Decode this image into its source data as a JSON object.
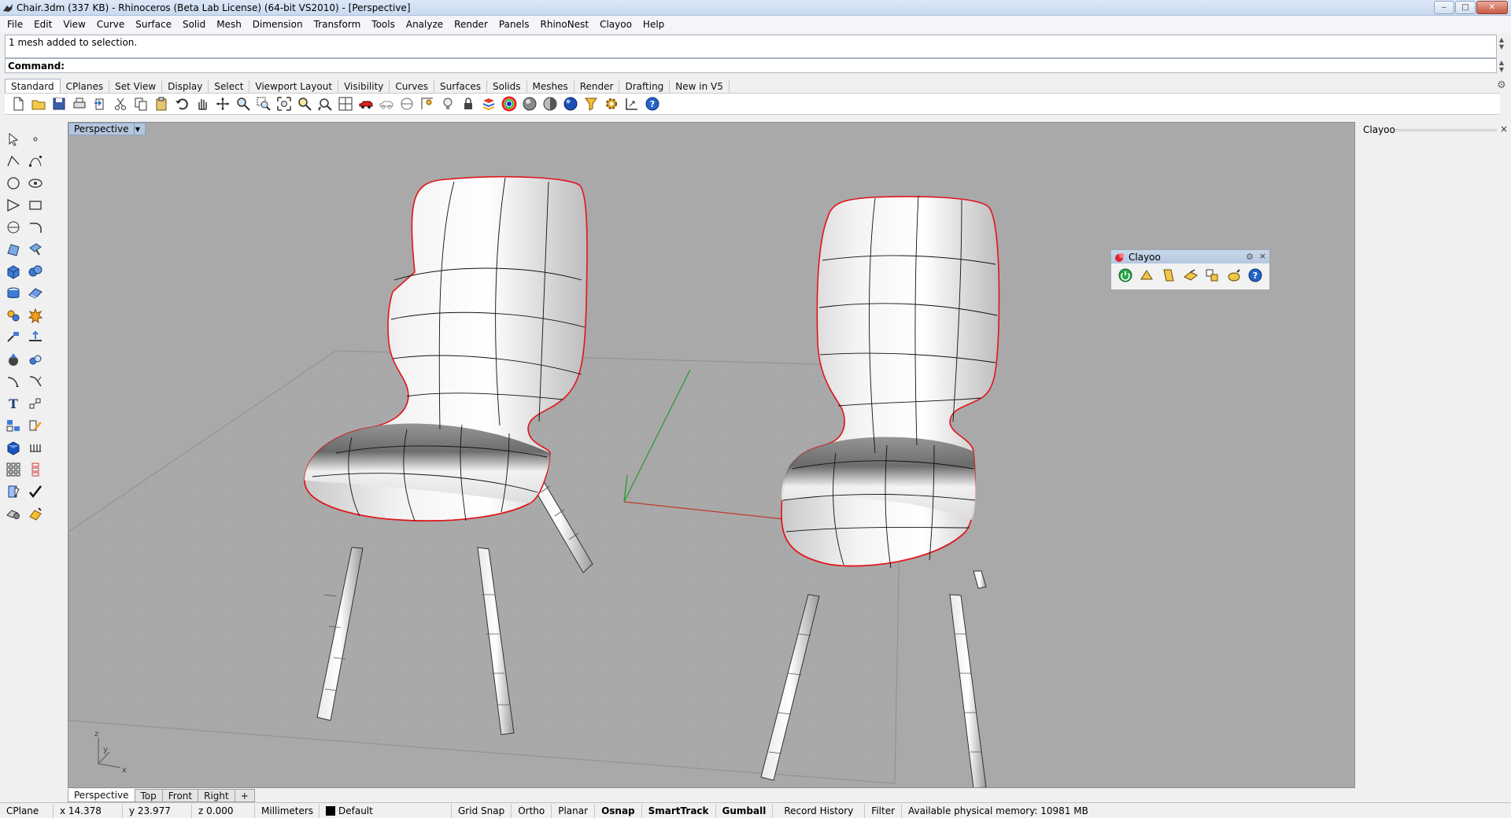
{
  "window": {
    "title": "Chair.3dm (337 KB) - Rhinoceros (Beta Lab License) (64-bit VS2010) - [Perspective]",
    "minimize": "‒",
    "maximize": "□",
    "close": "✕"
  },
  "menu": [
    "File",
    "Edit",
    "View",
    "Curve",
    "Surface",
    "Solid",
    "Mesh",
    "Dimension",
    "Transform",
    "Tools",
    "Analyze",
    "Render",
    "Panels",
    "RhinoNest",
    "Clayoo",
    "Help"
  ],
  "command": {
    "history": "1 mesh added to selection.",
    "label": "Command:",
    "value": ""
  },
  "toolbar_tabs": [
    "Standard",
    "CPlanes",
    "Set View",
    "Display",
    "Select",
    "Viewport Layout",
    "Visibility",
    "Curves",
    "Surfaces",
    "Solids",
    "Meshes",
    "Render",
    "Drafting",
    "New in V5"
  ],
  "toolbar_tabs_active": "Standard",
  "viewport": {
    "title": "Perspective",
    "axis_x": "x",
    "axis_y": "y",
    "axis_z": "z"
  },
  "viewport_tabs": [
    "Perspective",
    "Top",
    "Front",
    "Right"
  ],
  "viewport_tabs_add": "+",
  "right_panel": {
    "title": "Clayoo",
    "close": "×"
  },
  "floating_toolbar": {
    "title": "Clayoo",
    "close": "×"
  },
  "status": {
    "cplane": "CPlane",
    "x": "x 14.378",
    "y": "y 23.977",
    "z": "z 0.000",
    "units": "Millimeters",
    "layer": "Default",
    "grid_snap": "Grid Snap",
    "ortho": "Ortho",
    "planar": "Planar",
    "osnap": "Osnap",
    "smarttrack": "SmartTrack",
    "gumball": "Gumball",
    "record_history": "Record History",
    "filter": "Filter",
    "memory": "Available physical memory: 10981 MB"
  },
  "colors": {
    "viewport_bg": "#a9a9a9",
    "grid": "#9a9a9a",
    "x_axis": "#c0392b",
    "y_axis": "#2e9a2e",
    "selection": "#e0151a"
  }
}
